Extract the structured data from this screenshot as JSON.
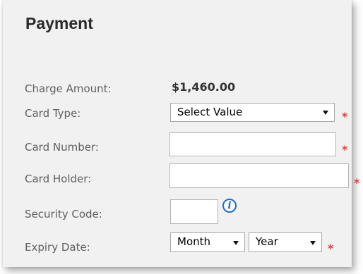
{
  "title": "Payment",
  "fields": {
    "charge_amount": {
      "label": "Charge Amount:",
      "value": "$1,460.00"
    },
    "card_type": {
      "label": "Card Type:",
      "selected": "Select Value"
    },
    "card_number": {
      "label": "Card Number:",
      "value": ""
    },
    "card_holder": {
      "label": "Card Holder:",
      "value": ""
    },
    "security_code": {
      "label": "Security Code:",
      "value": "",
      "info_glyph": "i"
    },
    "expiry_date": {
      "label": "Expiry Date:",
      "month": "Month",
      "year": "Year"
    }
  },
  "required_marker": "*",
  "colors": {
    "panel_background": "#f1f1f1",
    "required": "#e33b3b",
    "info": "#1f6fc4",
    "label": "#5f5f5f"
  },
  "icons": {
    "info": "info-circle-icon",
    "dropdown": "triangle-down-icon"
  }
}
